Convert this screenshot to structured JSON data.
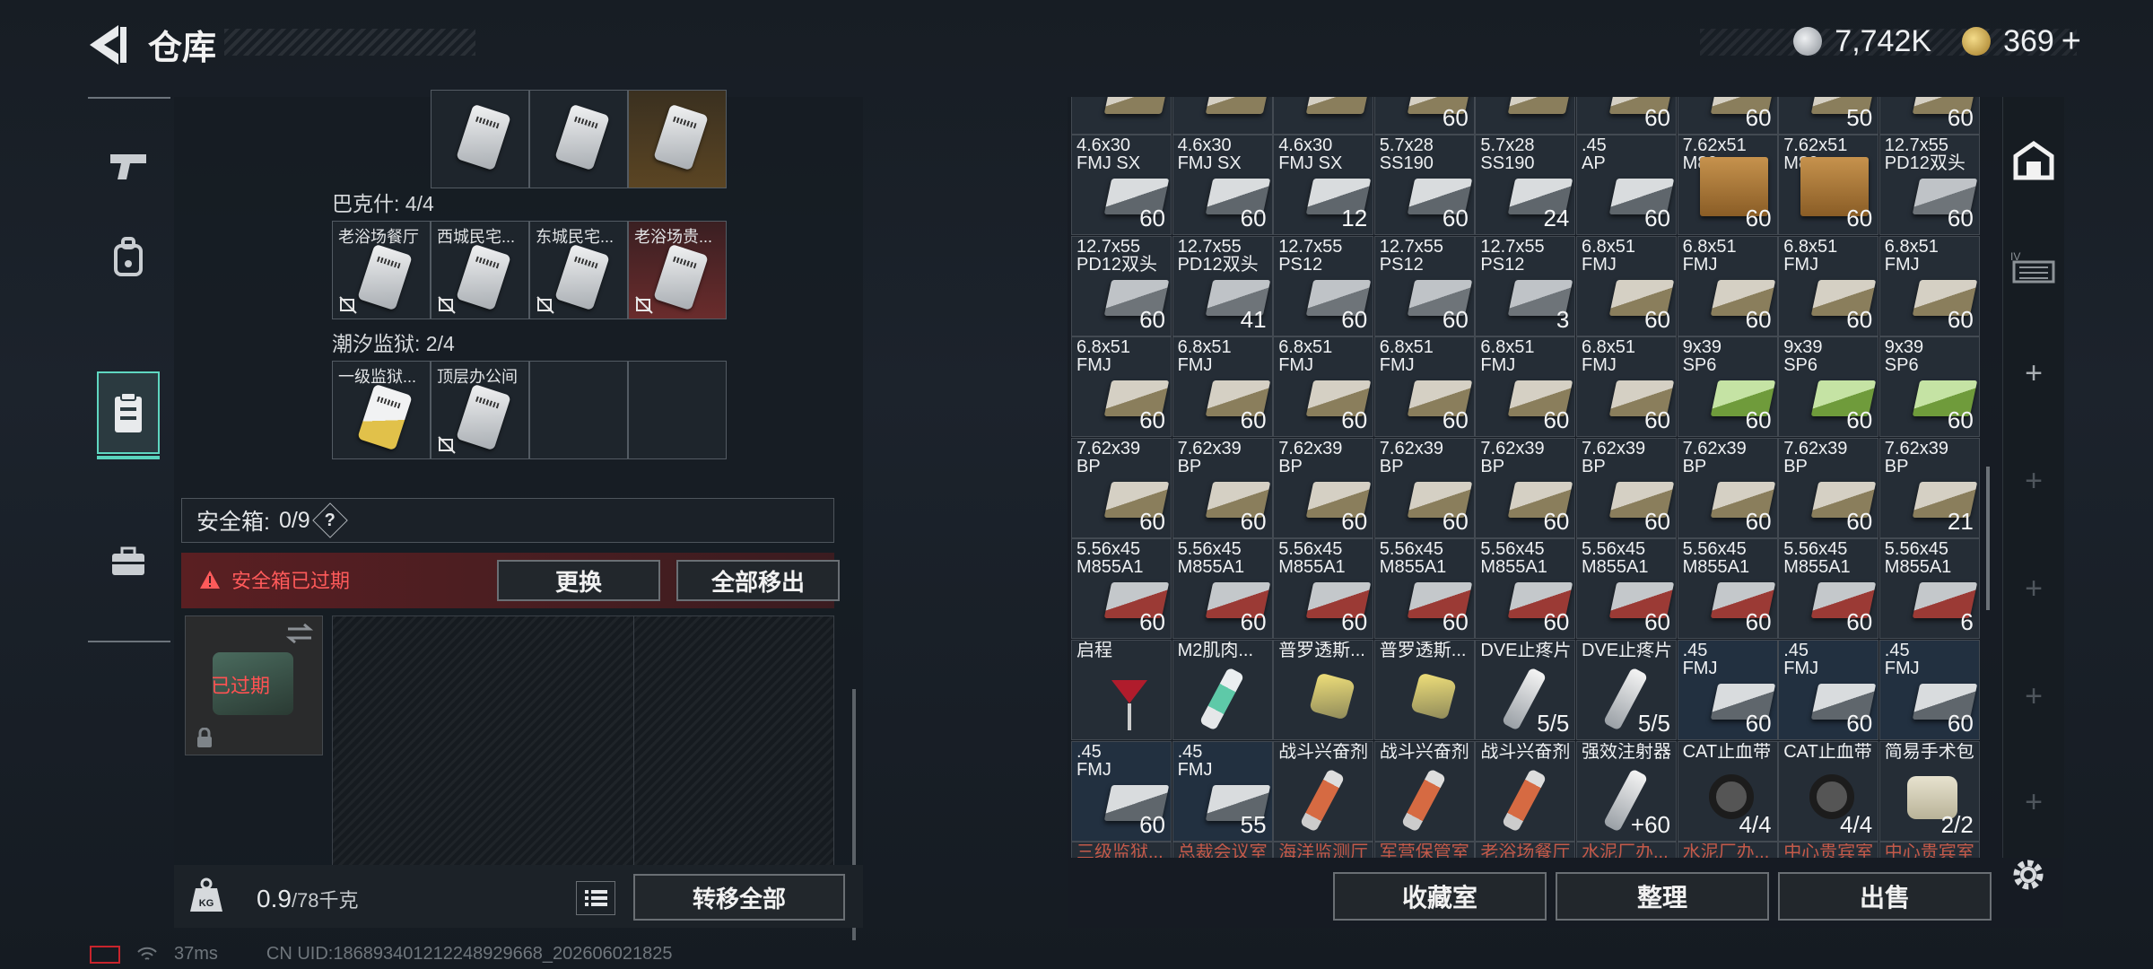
{
  "header": {
    "title": "仓库",
    "currency_silver": "7,742K",
    "currency_gold": "369",
    "gold_plus": "+"
  },
  "left": {
    "groups": [
      {
        "label": "",
        "items": [
          {
            "name": "",
            "color": "grey"
          },
          {
            "name": "",
            "color": "grey"
          },
          {
            "name": "",
            "color": "gold"
          }
        ]
      },
      {
        "label": "巴克什: 4/4",
        "items": [
          {
            "name": "老浴场餐厅",
            "color": "grey"
          },
          {
            "name": "西城民宅...",
            "color": "grey"
          },
          {
            "name": "东城民宅...",
            "color": "grey"
          },
          {
            "name": "老浴场贵...",
            "color": "red"
          }
        ]
      },
      {
        "label": "潮汐监狱: 2/4",
        "items": [
          {
            "name": "一级监狱...",
            "color": "grey"
          },
          {
            "name": "顶层办公间",
            "color": "grey"
          }
        ]
      }
    ],
    "safe_label": "安全箱:",
    "safe_value": "0/9",
    "safe_help": "?",
    "expired_warning": "安全箱已过期",
    "replace_button": "更换",
    "remove_all_button": "全部移出",
    "safebox_status": "已过期",
    "weight_value": "0.9",
    "weight_max": "/78千克",
    "weight_icon_text": "KG",
    "transfer_all_button": "转移全部"
  },
  "right": {
    "top_partial_qty": [
      "",
      "",
      "",
      "60",
      "",
      "60",
      "60",
      "50",
      "60"
    ],
    "rows": [
      [
        {
          "n": "4.6x30\nFMJ SX",
          "q": "60",
          "t": "grey"
        },
        {
          "n": "4.6x30\nFMJ SX",
          "q": "60",
          "t": "grey"
        },
        {
          "n": "4.6x30\nFMJ SX",
          "q": "12",
          "t": "grey"
        },
        {
          "n": "5.7x28\nSS190",
          "q": "60",
          "t": "grey"
        },
        {
          "n": "5.7x28\nSS190",
          "q": "24",
          "t": "grey"
        },
        {
          "n": ".45\nAP",
          "q": "60",
          "t": "grey"
        },
        {
          "n": "7.62x51\nM80",
          "q": "60",
          "t": "crate"
        },
        {
          "n": "7.62x51\nM80",
          "q": "60",
          "t": "crate"
        },
        {
          "n": "12.7x55\nPD12双头",
          "q": "60",
          "t": "gray2"
        }
      ],
      [
        {
          "n": "12.7x55\nPD12双头",
          "q": "60",
          "t": "gray2"
        },
        {
          "n": "12.7x55\nPD12双头",
          "q": "41",
          "t": "gray2"
        },
        {
          "n": "12.7x55\nPS12",
          "q": "60",
          "t": "gray2"
        },
        {
          "n": "12.7x55\nPS12",
          "q": "60",
          "t": "gray2"
        },
        {
          "n": "12.7x55\nPS12",
          "q": "3",
          "t": "gray2"
        },
        {
          "n": "6.8x51\nFMJ",
          "q": "60",
          "t": "tan"
        },
        {
          "n": "6.8x51\nFMJ",
          "q": "60",
          "t": "tan"
        },
        {
          "n": "6.8x51\nFMJ",
          "q": "60",
          "t": "tan"
        },
        {
          "n": "6.8x51\nFMJ",
          "q": "60",
          "t": "tan"
        }
      ],
      [
        {
          "n": "6.8x51\nFMJ",
          "q": "60",
          "t": "tan"
        },
        {
          "n": "6.8x51\nFMJ",
          "q": "60",
          "t": "tan"
        },
        {
          "n": "6.8x51\nFMJ",
          "q": "60",
          "t": "tan"
        },
        {
          "n": "6.8x51\nFMJ",
          "q": "60",
          "t": "tan"
        },
        {
          "n": "6.8x51\nFMJ",
          "q": "60",
          "t": "tan"
        },
        {
          "n": "6.8x51\nFMJ",
          "q": "60",
          "t": "tan"
        },
        {
          "n": "9x39\nSP6",
          "q": "60",
          "t": "green"
        },
        {
          "n": "9x39\nSP6",
          "q": "60",
          "t": "green"
        },
        {
          "n": "9x39\nSP6",
          "q": "60",
          "t": "green"
        }
      ],
      [
        {
          "n": "7.62x39\nBP",
          "q": "60",
          "t": "tan"
        },
        {
          "n": "7.62x39\nBP",
          "q": "60",
          "t": "tan"
        },
        {
          "n": "7.62x39\nBP",
          "q": "60",
          "t": "tan"
        },
        {
          "n": "7.62x39\nBP",
          "q": "60",
          "t": "tan"
        },
        {
          "n": "7.62x39\nBP",
          "q": "60",
          "t": "tan"
        },
        {
          "n": "7.62x39\nBP",
          "q": "60",
          "t": "tan"
        },
        {
          "n": "7.62x39\nBP",
          "q": "60",
          "t": "tan"
        },
        {
          "n": "7.62x39\nBP",
          "q": "60",
          "t": "tan"
        },
        {
          "n": "7.62x39\nBP",
          "q": "21",
          "t": "tan"
        }
      ],
      [
        {
          "n": "5.56x45\nM855A1",
          "q": "60",
          "t": "red"
        },
        {
          "n": "5.56x45\nM855A1",
          "q": "60",
          "t": "red"
        },
        {
          "n": "5.56x45\nM855A1",
          "q": "60",
          "t": "red"
        },
        {
          "n": "5.56x45\nM855A1",
          "q": "60",
          "t": "red"
        },
        {
          "n": "5.56x45\nM855A1",
          "q": "60",
          "t": "red"
        },
        {
          "n": "5.56x45\nM855A1",
          "q": "60",
          "t": "red"
        },
        {
          "n": "5.56x45\nM855A1",
          "q": "60",
          "t": "red"
        },
        {
          "n": "5.56x45\nM855A1",
          "q": "60",
          "t": "red"
        },
        {
          "n": "5.56x45\nM855A1",
          "q": "6",
          "t": "red"
        }
      ],
      [
        {
          "n": "启程",
          "q": "",
          "t": "cup"
        },
        {
          "n": "M2肌肉...",
          "q": "",
          "t": "med"
        },
        {
          "n": "普罗透斯...",
          "q": "",
          "t": "pill"
        },
        {
          "n": "普罗透斯...",
          "q": "",
          "t": "pill"
        },
        {
          "n": "DVE止疼片",
          "q": "5/5",
          "t": "white"
        },
        {
          "n": "DVE止疼片",
          "q": "5/5",
          "t": "white"
        },
        {
          "n": ".45\nFMJ",
          "q": "60",
          "t": "grey",
          "b": 1
        },
        {
          "n": ".45\nFMJ",
          "q": "60",
          "t": "grey",
          "b": 1
        },
        {
          "n": ".45\nFMJ",
          "q": "60",
          "t": "grey",
          "b": 1
        }
      ],
      [
        {
          "n": ".45\nFMJ",
          "q": "60",
          "t": "grey",
          "b": 1
        },
        {
          "n": ".45\nFMJ",
          "q": "55",
          "t": "grey",
          "b": 1
        },
        {
          "n": "战斗兴奋剂",
          "q": "",
          "t": "orange"
        },
        {
          "n": "战斗兴奋剂",
          "q": "",
          "t": "orange"
        },
        {
          "n": "战斗兴奋剂",
          "q": "",
          "t": "orange"
        },
        {
          "n": "强效注射器",
          "q": "+60",
          "t": "white"
        },
        {
          "n": "CAT止血带",
          "q": "4/4",
          "t": "tq"
        },
        {
          "n": "CAT止血带",
          "q": "4/4",
          "t": "tq"
        },
        {
          "n": "简易手术包",
          "q": "2/2",
          "t": "bag"
        }
      ]
    ],
    "bottom_partial": [
      "三级监狱...",
      "总裁会议室",
      "海洋监测厅",
      "军营保管室",
      "老浴场餐厅",
      "水泥厂办...",
      "水泥厂办...",
      "中心贵宾室",
      "中心贵宾室"
    ],
    "collection_button": "收藏室",
    "sort_button": "整理",
    "sell_button": "出售"
  },
  "status": {
    "ping": "37ms",
    "uid": "CN UID:1868934012122489296​68_202606021825"
  }
}
